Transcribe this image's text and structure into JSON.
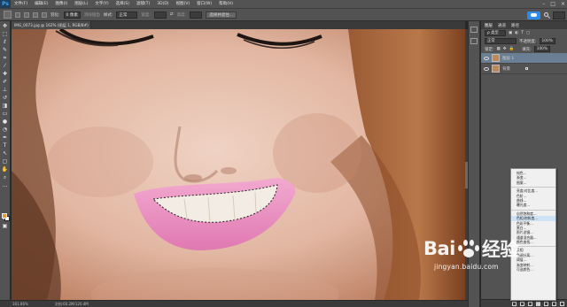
{
  "app": {
    "logo": "Ps",
    "menus": [
      "文件(F)",
      "编辑(E)",
      "图像(I)",
      "图层(L)",
      "文字(Y)",
      "选择(S)",
      "滤镜(T)",
      "3D(D)",
      "视图(V)",
      "窗口(W)",
      "帮助(H)"
    ]
  },
  "options": {
    "feather_label": "羽化:",
    "feather_value": "0 像素",
    "antialias": "消除锯齿",
    "style_label": "样式:",
    "style_value": "正常",
    "width_label": "宽度:",
    "height_label": "高度:",
    "refine_button": "选择并遮住..."
  },
  "document": {
    "tab": "IMG_0073.jpg @ 162% (图层 1, RGB/8#)",
    "zoom": "161.86%",
    "doc_size": "文档:60.2M/120.4M"
  },
  "layers": {
    "tabs": [
      "图层",
      "通道",
      "路径"
    ],
    "kind_label": "ρ 类型",
    "blend_mode": "正常",
    "opacity_label": "不透明度:",
    "opacity_value": "100%",
    "lock_label": "锁定:",
    "fill_label": "填充:",
    "fill_value": "100%",
    "items": [
      {
        "name": "图层 1",
        "selected": true
      },
      {
        "name": "背景",
        "selected": false
      }
    ]
  },
  "adjust_menu": {
    "items": [
      "纯色...",
      "渐变...",
      "图案...",
      "—",
      "亮度/对比度...",
      "色阶...",
      "曲线...",
      "曝光度...",
      "—",
      "自然饱和度...",
      "色相/饱和度...",
      "色彩平衡...",
      "黑白...",
      "照片滤镜...",
      "通道混合器...",
      "颜色查找...",
      "—",
      "反相",
      "色调分离...",
      "阈值...",
      "渐变映射...",
      "可选颜色..."
    ],
    "highlighted": "色相/饱和度..."
  },
  "watermark": {
    "brand": "Bai  百度",
    "sub": "jingyan.baidu.com"
  },
  "colors": {
    "foreground": "#e39b2c",
    "background": "#ffffff",
    "ui_dark": "#535353",
    "accent": "#2d8ceb"
  }
}
